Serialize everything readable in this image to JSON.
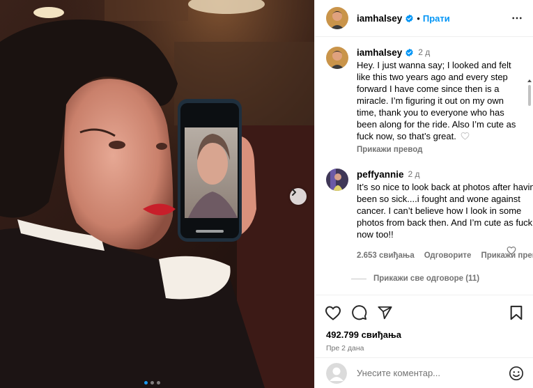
{
  "post": {
    "username": "iamhalsey",
    "follow_label": "Прати",
    "caption_time": "2 д",
    "caption": "Hey. I just wanna say; I looked and felt like this two years ago and every step forward I have come since then is a miracle. I’m figuring it out on my own time, thank you to everyone who has been along for the ride. Also I’m cute as fuck now, so that’s great.",
    "translate_label": "Прикажи превод",
    "likes": "492.799 свиђања",
    "posted_ago": "Пре 2 дана",
    "carousel_index": 1,
    "carousel_total": 3
  },
  "comment": {
    "username": "peffyannie",
    "time": "2 д",
    "text": "It’s so nice to look back at photos after having been so sick....i fought and wone against cancer. I can’t believe how I look in some photos from back then. And I’m cute as fuck now too!!",
    "likes": "2.653 свиђања",
    "reply_label": "Одговорите",
    "translate_label": "Прикажи прево",
    "view_replies": "Прикажи све одговоре (11)"
  },
  "composer": {
    "placeholder": "Унесите коментар..."
  },
  "colors": {
    "accent": "#0095f6",
    "verified": "#0095f6",
    "muted": "#737373"
  },
  "icons": [
    "more-icon",
    "verified-icon",
    "heart-icon",
    "comment-icon",
    "share-icon",
    "save-icon",
    "emoji-icon",
    "chevron-right-icon"
  ]
}
